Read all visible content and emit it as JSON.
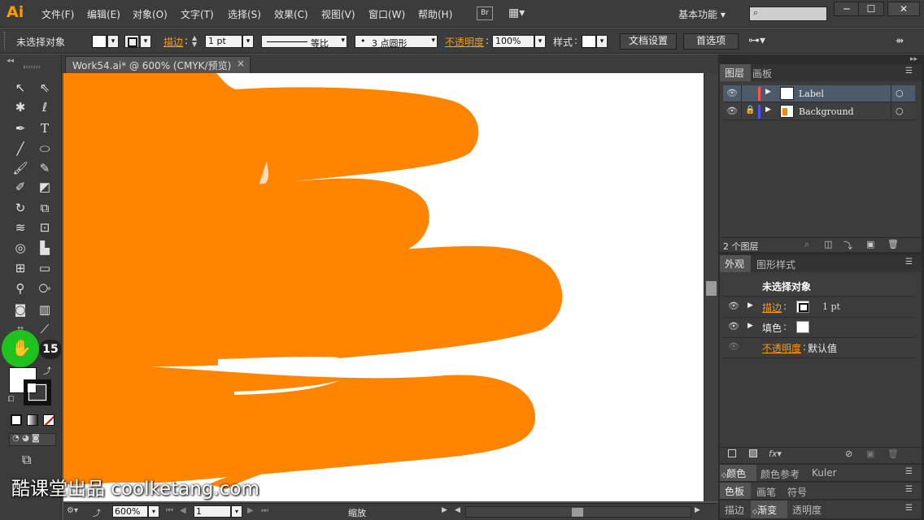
{
  "app": {
    "logo": "Ai",
    "menu": [
      "文件(F)",
      "编辑(E)",
      "对象(O)",
      "文字(T)",
      "选择(S)",
      "效果(C)",
      "视图(V)",
      "窗口(W)",
      "帮助(H)"
    ],
    "bridge_label": "Br",
    "workspace": "基本功能",
    "window_controls": [
      "─",
      "☐",
      "✕"
    ]
  },
  "control_bar": {
    "selection_status": "未选择对象",
    "stroke_label": "描边",
    "stroke_weight": "1 pt",
    "profile_label": "等比",
    "brush_label": "3 点圆形",
    "opacity_label": "不透明度",
    "opacity_value": "100%",
    "style_label": "样式",
    "doc_setup_button": "文档设置",
    "prefs_button": "首选项"
  },
  "document": {
    "tab_title": "Work54.ai* @ 600% (CMYK/预览)",
    "close_glyph": "×"
  },
  "tools": {
    "stroke_count_badge": "15"
  },
  "status_bar": {
    "zoom": "600%",
    "page": "1",
    "tool_name": "缩放"
  },
  "layers_panel": {
    "tabs": [
      "图层",
      "画板"
    ],
    "layers": [
      {
        "name": "Label",
        "color": "#ff4f4f"
      },
      {
        "name": "Background",
        "color": "#4f4fff"
      }
    ],
    "footer_count": "2 个图层"
  },
  "appearance_panel": {
    "tabs": [
      "外观",
      "图形样式"
    ],
    "header": "未选择对象",
    "stroke_label": "描边",
    "stroke_value": "1 pt",
    "fill_label": "填色",
    "opacity_label": "不透明度",
    "opacity_value": "默认值"
  },
  "collapsed_panels": {
    "row1": [
      "颜色",
      "颜色参考",
      "Kuler"
    ],
    "row2": [
      "色板",
      "画笔",
      "符号"
    ],
    "row3": [
      "描边",
      "渐变",
      "透明度"
    ]
  },
  "watermark": "酷课堂出品 coolketang.com",
  "colors": {
    "accent": "#ff9a00",
    "brush_orange": "#ff8400",
    "ui_dark": "#3c3c3c",
    "ui_mid": "#535353"
  }
}
